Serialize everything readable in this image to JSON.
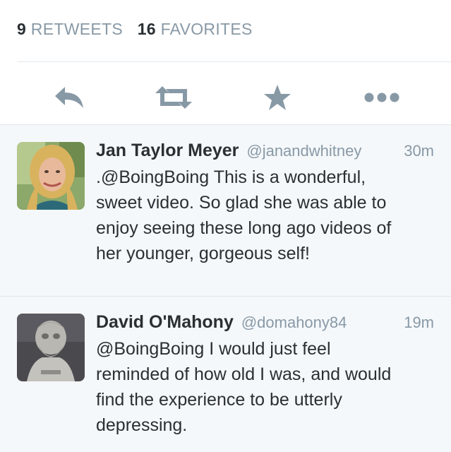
{
  "stats": {
    "retweets_count": "9",
    "retweets_label": "RETWEETS",
    "favorites_count": "16",
    "favorites_label": "FAVORITES"
  },
  "actions": {
    "reply_icon": "reply-icon",
    "retweet_icon": "retweet-icon",
    "favorite_icon": "star-icon",
    "more_icon": "more-icon",
    "icon_color": "#8899a6"
  },
  "replies": [
    {
      "name": "Jan Taylor Meyer",
      "handle": "@janandwhitney",
      "time": "30m",
      "text_lines": [
        ".@BoingBoing This is a wonderful,",
        "sweet video. So glad she was able to",
        "enjoy seeing these long ago videos of",
        "her younger, gorgeous self!"
      ]
    },
    {
      "name": "David O'Mahony",
      "handle": "@domahony84",
      "time": "19m",
      "text_lines": [
        "@BoingBoing I would just feel",
        "reminded of how old I was, and would",
        "find the experience to be utterly",
        "depressing."
      ]
    }
  ],
  "colors": {
    "muted": "#8899a6",
    "text": "#292f33",
    "reply_bg": "#f5f8fa",
    "divider": "#e1e8ed"
  }
}
